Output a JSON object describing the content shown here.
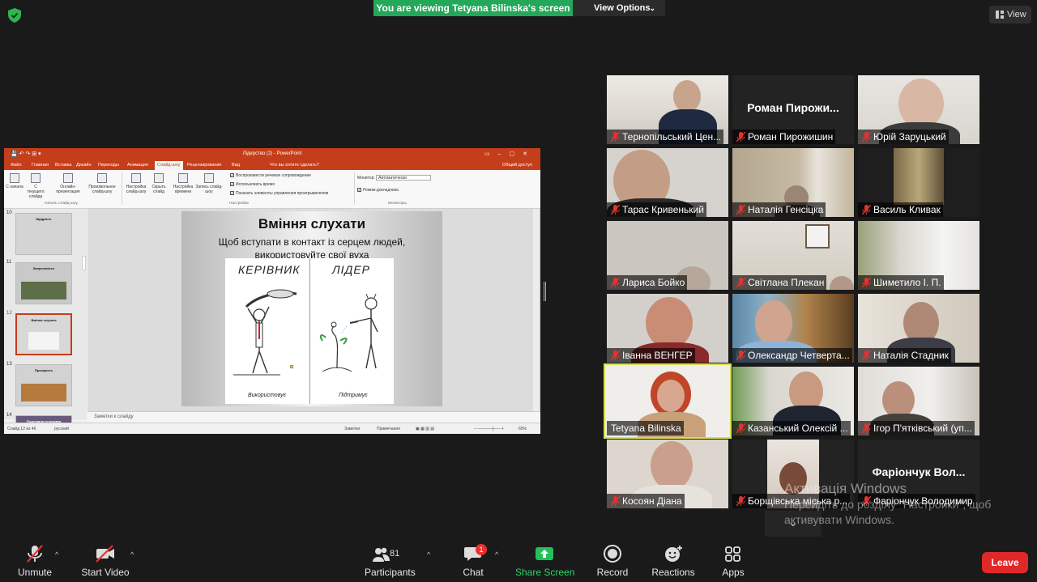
{
  "banner": {
    "viewing": "You are viewing Tetyana Bilinska's screen",
    "view_options": "View Options"
  },
  "view_button": "View",
  "ppt": {
    "doc_title": "Лідерство (2) - PowerPoint",
    "tabs": [
      "Файл",
      "Главная",
      "Вставка",
      "Дизайн",
      "Переходы",
      "Анимация",
      "Слайд-шоу",
      "Рецензирование",
      "Вид"
    ],
    "active_tab": "Слайд-шоу",
    "tell_me": "Что вы хотите сделать?",
    "share": "Общий доступ",
    "ribbon_buttons": [
      "С начала",
      "С текущего слайда",
      "Онлайн-презентация",
      "Произвольное слайд-шоу",
      "Настройка слайд-шоу",
      "Скрыть слайд",
      "Настройка времени",
      "Запись слайд-шоу"
    ],
    "group_start": "Начать слайд-шоу",
    "group_setup": "Настройка",
    "group_monitors": "Мониторы",
    "checks": [
      "Воспроизвести речевое сопровождение",
      "Использовать время",
      "Показать элементы управления проигрывателем"
    ],
    "monitor_label": "Монитор:",
    "monitor_value": "Автоматически",
    "presenter_mode": "Режим докладчика",
    "thumbs": [
      {
        "num": "10",
        "title": "Щедрість"
      },
      {
        "num": "11",
        "title": "Залученність"
      },
      {
        "num": "12",
        "title": "Вміння слухати"
      },
      {
        "num": "13",
        "title": "Прозорість"
      },
      {
        "num": "14",
        "title": "Позитивна установка"
      }
    ],
    "slide": {
      "title": "Вміння слухати",
      "subtitle": "Щоб вступати в контакт із серцем людей, використовуйте свої вуха",
      "left_label": "КЕРІВНИК",
      "right_label": "ЛІДЕР",
      "left_caption": "Використовує",
      "right_caption": "Підтримує"
    },
    "notes": "Заметки к слайду",
    "status_slide": "Слайд 12 из 46",
    "status_lang": "русский",
    "status_notes": "Заметки",
    "status_comments": "Примечания",
    "zoom": "65%"
  },
  "participants": [
    {
      "name": "Тернопільський Цен...",
      "muted": true
    },
    {
      "name": "Роман Пирожишин",
      "big": "Роман  Пирожи...",
      "muted": true
    },
    {
      "name": "Юрій Заруцький",
      "muted": true
    },
    {
      "name": "Тарас Кривенький",
      "muted": true
    },
    {
      "name": "Наталія Генсіцка",
      "muted": true
    },
    {
      "name": "Василь Кливак",
      "muted": true
    },
    {
      "name": "Лариса Бойко",
      "muted": true
    },
    {
      "name": "Світлана Плекан",
      "muted": true
    },
    {
      "name": "Шиметило І. П.",
      "muted": true
    },
    {
      "name": "Іванна ВЕНГЕР",
      "muted": true
    },
    {
      "name": "Олександр Четверта...",
      "muted": true
    },
    {
      "name": "Наталія Стадник",
      "muted": true
    },
    {
      "name": "Tetyana Bilinska",
      "muted": false
    },
    {
      "name": "Казанський Олексій ...",
      "muted": true
    },
    {
      "name": "Ігор П'ятківський (уп...",
      "muted": true
    },
    {
      "name": "Косоян Діана",
      "muted": true
    },
    {
      "name": "Борщівська міська р...",
      "muted": true
    },
    {
      "name": "Фаріончук Володимир",
      "big": "Фаріончук  Вол...",
      "muted": true
    }
  ],
  "watermark": {
    "line1": "Активація Windows",
    "line2": "Перейдіть до розділу \"Настройки\", щоб",
    "line3": "активувати Windows."
  },
  "toolbar": {
    "unmute": "Unmute",
    "start_video": "Start Video",
    "participants": "Participants",
    "participants_count": "81",
    "chat": "Chat",
    "chat_badge": "1",
    "share_screen": "Share Screen",
    "record": "Record",
    "reactions": "Reactions",
    "apps": "Apps",
    "leave": "Leave"
  },
  "colors": {
    "share_green": "#23a859",
    "leave_red": "#e02828",
    "active_speaker": "#d6e050",
    "ppt_accent": "#c43e1c"
  }
}
